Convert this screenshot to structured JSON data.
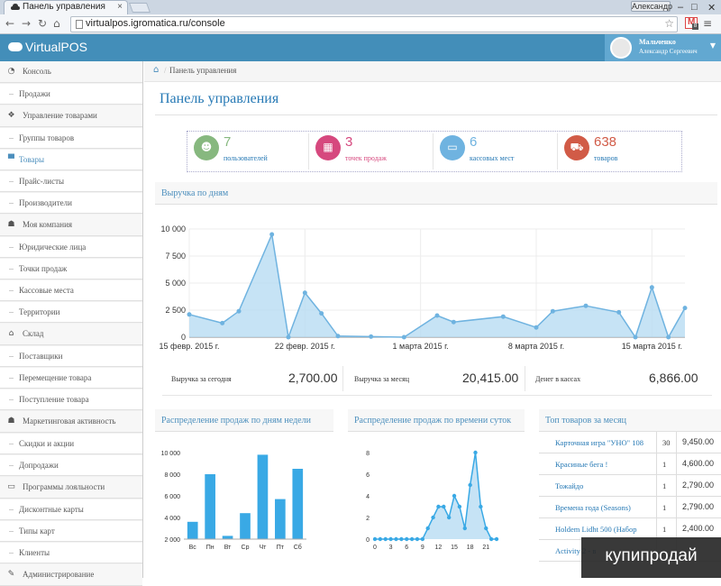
{
  "browser": {
    "tab_title": "Панель управления",
    "tab_close": "×",
    "user_chip": "Александр",
    "url": "virtualpos.igromatica.ru/console",
    "minimize": "–",
    "maximize": "□",
    "close": "✕",
    "gmail_badge": "8"
  },
  "app": {
    "logo": "VirtualPOS",
    "user_name": "Мальченко",
    "user_full": "Александр Сергеевич"
  },
  "sidebar": {
    "items": [
      {
        "label": "Консоль",
        "kind": "main",
        "icon": "tachometer-icon",
        "glyph": "◔"
      },
      {
        "label": "Продажи",
        "kind": "sub"
      },
      {
        "label": "Управление товарами",
        "kind": "main",
        "icon": "dropbox-icon",
        "glyph": "❖"
      },
      {
        "label": "Группы товаров",
        "kind": "sub"
      },
      {
        "label": "Товары",
        "kind": "sub",
        "active": true,
        "glyph": "▀"
      },
      {
        "label": "Прайс-листы",
        "kind": "sub"
      },
      {
        "label": "Производители",
        "kind": "sub"
      },
      {
        "label": "Моя компания",
        "kind": "main",
        "icon": "users-icon",
        "glyph": "☗"
      },
      {
        "label": "Юридические лица",
        "kind": "sub"
      },
      {
        "label": "Точки продаж",
        "kind": "sub"
      },
      {
        "label": "Кассовые места",
        "kind": "sub"
      },
      {
        "label": "Территории",
        "kind": "sub"
      },
      {
        "label": "Склад",
        "kind": "main",
        "icon": "home-icon",
        "glyph": "⌂"
      },
      {
        "label": "Поставщики",
        "kind": "sub"
      },
      {
        "label": "Перемещение товара",
        "kind": "sub"
      },
      {
        "label": "Поступление товара",
        "kind": "sub"
      },
      {
        "label": "Маркетинговая активность",
        "kind": "main",
        "icon": "users-icon",
        "glyph": "☗"
      },
      {
        "label": "Скидки и акции",
        "kind": "sub"
      },
      {
        "label": "Допродажи",
        "kind": "sub"
      },
      {
        "label": "Программы лояльности",
        "kind": "main",
        "icon": "credit-card-icon",
        "glyph": "▭"
      },
      {
        "label": "Дисконтные карты",
        "kind": "sub"
      },
      {
        "label": "Типы карт",
        "kind": "sub"
      },
      {
        "label": "Клиенты",
        "kind": "sub"
      },
      {
        "label": "Администрирование",
        "kind": "main",
        "icon": "wrench-icon",
        "glyph": "✎"
      }
    ]
  },
  "breadcrumb": {
    "current": "Панель управления"
  },
  "page_title": "Панель управления",
  "stats": [
    {
      "value": "7",
      "label": "пользователей",
      "color": "#87b87f",
      "icon": "users-icon",
      "glyph": "☻"
    },
    {
      "value": "3",
      "label": "точек продаж",
      "color": "#d6487e",
      "icon": "building-icon",
      "glyph": "▦"
    },
    {
      "value": "6",
      "label": "кассовых мест",
      "color": "#6fb3e0",
      "icon": "desktop-icon",
      "glyph": "▭"
    },
    {
      "value": "638",
      "label": "товаров",
      "color": "#d15b47",
      "icon": "cart-icon",
      "glyph": "⛟"
    }
  ],
  "revenue": {
    "title": "Выручка по дням",
    "today_label": "Выручка за сегодня",
    "today_value": "2,700.00",
    "month_label": "Выручка за месяц",
    "month_value": "20,415.00",
    "cash_label": "Денег в кассах",
    "cash_value": "6,866.00"
  },
  "weekday": {
    "title": "Распределение продаж по дням недели"
  },
  "hourly": {
    "title": "Распределение продаж по времени суток"
  },
  "top": {
    "title": "Топ товаров за месяц",
    "rows": [
      {
        "name": "Карточная игра \"УНО\" 108",
        "qty": "30",
        "sum": "9,450.00"
      },
      {
        "name": "Красиные бега !",
        "qty": "1",
        "sum": "4,600.00"
      },
      {
        "name": "Тожайдо",
        "qty": "1",
        "sum": "2,790.00"
      },
      {
        "name": "Времена года (Seasons)",
        "qty": "1",
        "sum": "2,790.00"
      },
      {
        "name": "Holdem Lidht 500 (Набор",
        "qty": "1",
        "sum": "2,400.00"
      },
      {
        "name": "Activity 2 - в",
        "qty": "",
        "sum": ""
      }
    ]
  },
  "watermark": "купипродай",
  "chart_data": [
    {
      "type": "area",
      "title": "Выручка по дням",
      "x": [
        "2015-02-15",
        "2015-02-16",
        "2015-02-17",
        "2015-02-18",
        "2015-02-19",
        "2015-02-20",
        "2015-02-21",
        "2015-02-22",
        "2015-02-23",
        "2015-02-24",
        "2015-02-25",
        "2015-02-26",
        "2015-02-27",
        "2015-02-28",
        "2015-03-01",
        "2015-03-02",
        "2015-03-03",
        "2015-03-04",
        "2015-03-05",
        "2015-03-06",
        "2015-03-07",
        "2015-03-08",
        "2015-03-09",
        "2015-03-10",
        "2015-03-11",
        "2015-03-12",
        "2015-03-13",
        "2015-03-14",
        "2015-03-15",
        "2015-03-16",
        "2015-03-17"
      ],
      "values": [
        2100,
        null,
        1300,
        2400,
        null,
        9500,
        0,
        4100,
        2200,
        100,
        null,
        50,
        null,
        0,
        null,
        2000,
        1400,
        null,
        null,
        1900,
        null,
        900,
        2400,
        null,
        2900,
        null,
        2300,
        0,
        4600,
        0,
        2700
      ],
      "xticks": [
        "15 февр. 2015 г.",
        "22 февр. 2015 г.",
        "1 марта 2015 г.",
        "8 марта 2015 г.",
        "15 марта 2015 г."
      ],
      "yticks": [
        "10 000",
        "7 500",
        "5 000",
        "2 500",
        "0"
      ],
      "ylim": [
        0,
        10000
      ],
      "grid": true,
      "color": "#6fb3e0"
    },
    {
      "type": "bar",
      "title": "Распределение продаж по дням недели",
      "categories": [
        "Вс",
        "Пн",
        "Вт",
        "Ср",
        "Чт",
        "Пт",
        "Сб"
      ],
      "values": [
        3600,
        8000,
        2300,
        4400,
        9800,
        5700,
        8500
      ],
      "yticks": [
        "10 000",
        "8 000",
        "6 000",
        "4 000",
        "2 000"
      ],
      "ylim": [
        2000,
        10000
      ],
      "color": "#39a9e5"
    },
    {
      "type": "area",
      "title": "Распределение продаж по времени суток",
      "x": [
        0,
        1,
        2,
        3,
        4,
        5,
        6,
        7,
        8,
        9,
        10,
        11,
        12,
        13,
        14,
        15,
        16,
        17,
        18,
        19,
        20,
        21,
        22,
        23
      ],
      "values": [
        0,
        0,
        0,
        0,
        0,
        0,
        0,
        0,
        0,
        0,
        1,
        2,
        3,
        3,
        2,
        4,
        3,
        1,
        5,
        8,
        3,
        1,
        0,
        0
      ],
      "xticks": [
        "0",
        "3",
        "6",
        "9",
        "12",
        "15",
        "18",
        "21"
      ],
      "yticks": [
        "8",
        "6",
        "4",
        "2",
        "0"
      ],
      "ylim": [
        0,
        8
      ],
      "color": "#39a9e5"
    }
  ]
}
